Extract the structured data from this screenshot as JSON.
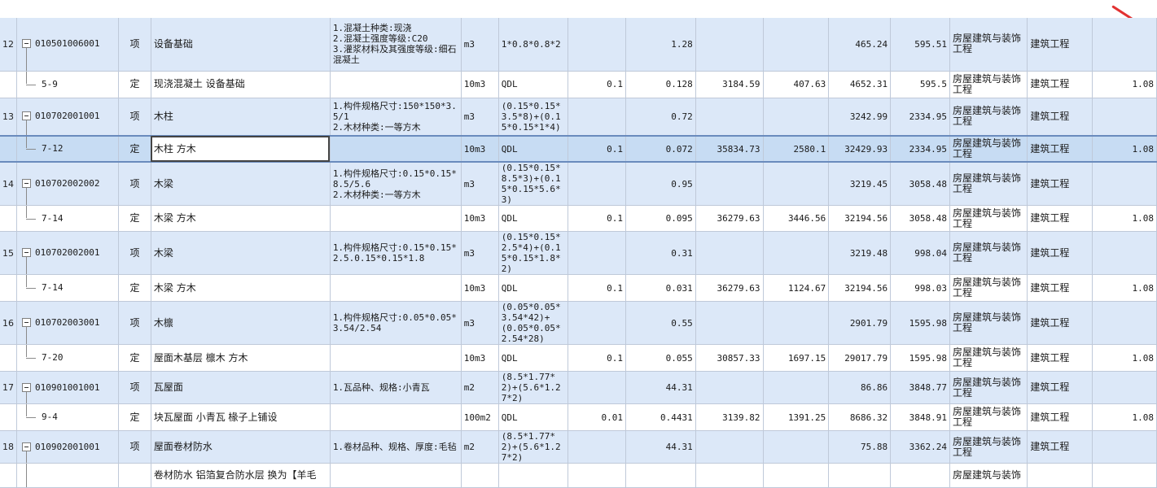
{
  "rows": [
    {
      "seq": "12",
      "type": "q",
      "code": "010501006001",
      "kind": "项",
      "name": "设备基础",
      "feature": "1.混凝土种类:现浇\n2.混凝土强度等级:C20\n3.灌浆材料及其强度等级:细石混凝土",
      "unit": "m3",
      "expr": "1*0.8*0.8*2",
      "coef": "",
      "qty": "1.28",
      "price": "",
      "amount": "",
      "unitprice": "465.24",
      "total": "595.51",
      "major": "房屋建筑与装饰工程",
      "category": "建筑工程",
      "extra": ""
    },
    {
      "seq": "",
      "type": "d",
      "code": "5-9",
      "kind": "定",
      "name": "现浇混凝土 设备基础",
      "feature": "",
      "unit": "10m3",
      "expr": "QDL",
      "coef": "0.1",
      "qty": "0.128",
      "price": "3184.59",
      "amount": "407.63",
      "unitprice": "4652.31",
      "total": "595.5",
      "major": "房屋建筑与装饰工程",
      "category": "建筑工程",
      "extra": "1.08"
    },
    {
      "seq": "13",
      "type": "q",
      "code": "010702001001",
      "kind": "项",
      "name": "木柱",
      "feature": "1.构件规格尺寸:150*150*3.5/1\n2.木材种类:一等方木",
      "unit": "m3",
      "expr": "(0.15*0.15*3.5*8)+(0.15*0.15*1*4)",
      "coef": "",
      "qty": "0.72",
      "price": "",
      "amount": "",
      "unitprice": "3242.99",
      "total": "2334.95",
      "major": "房屋建筑与装饰工程",
      "category": "建筑工程",
      "extra": ""
    },
    {
      "seq": "",
      "type": "d",
      "code": "7-12",
      "kind": "定",
      "name": "木柱 方木",
      "feature": "",
      "unit": "10m3",
      "expr": "QDL",
      "coef": "0.1",
      "qty": "0.072",
      "price": "35834.73",
      "amount": "2580.1",
      "unitprice": "32429.93",
      "total": "2334.95",
      "major": "房屋建筑与装饰工程",
      "category": "建筑工程",
      "extra": "1.08"
    },
    {
      "seq": "14",
      "type": "q",
      "code": "010702002002",
      "kind": "项",
      "name": "木梁",
      "feature": "1.构件规格尺寸:0.15*0.15*8.5/5.6\n2.木材种类:一等方木",
      "unit": "m3",
      "expr": "(0.15*0.15*8.5*3)+(0.15*0.15*5.6*3)",
      "coef": "",
      "qty": "0.95",
      "price": "",
      "amount": "",
      "unitprice": "3219.45",
      "total": "3058.48",
      "major": "房屋建筑与装饰工程",
      "category": "建筑工程",
      "extra": ""
    },
    {
      "seq": "",
      "type": "d",
      "code": "7-14",
      "kind": "定",
      "name": "木梁 方木",
      "feature": "",
      "unit": "10m3",
      "expr": "QDL",
      "coef": "0.1",
      "qty": "0.095",
      "price": "36279.63",
      "amount": "3446.56",
      "unitprice": "32194.56",
      "total": "3058.48",
      "major": "房屋建筑与装饰工程",
      "category": "建筑工程",
      "extra": "1.08"
    },
    {
      "seq": "15",
      "type": "q",
      "code": "010702002001",
      "kind": "项",
      "name": "木梁",
      "feature": "1.构件规格尺寸:0.15*0.15*2.5.0.15*0.15*1.8",
      "unit": "m3",
      "expr": "(0.15*0.15*2.5*4)+(0.15*0.15*1.8*2)",
      "coef": "",
      "qty": "0.31",
      "price": "",
      "amount": "",
      "unitprice": "3219.48",
      "total": "998.04",
      "major": "房屋建筑与装饰工程",
      "category": "建筑工程",
      "extra": ""
    },
    {
      "seq": "",
      "type": "d",
      "code": "7-14",
      "kind": "定",
      "name": "木梁 方木",
      "feature": "",
      "unit": "10m3",
      "expr": "QDL",
      "coef": "0.1",
      "qty": "0.031",
      "price": "36279.63",
      "amount": "1124.67",
      "unitprice": "32194.56",
      "total": "998.03",
      "major": "房屋建筑与装饰工程",
      "category": "建筑工程",
      "extra": "1.08"
    },
    {
      "seq": "16",
      "type": "q",
      "code": "010702003001",
      "kind": "项",
      "name": "木檩",
      "feature": "1.构件规格尺寸:0.05*0.05*3.54/2.54",
      "unit": "m3",
      "expr": "(0.05*0.05*3.54*42)+(0.05*0.05*2.54*28)",
      "coef": "",
      "qty": "0.55",
      "price": "",
      "amount": "",
      "unitprice": "2901.79",
      "total": "1595.98",
      "major": "房屋建筑与装饰工程",
      "category": "建筑工程",
      "extra": ""
    },
    {
      "seq": "",
      "type": "d",
      "code": "7-20",
      "kind": "定",
      "name": "屋面木基层 檩木 方木",
      "feature": "",
      "unit": "10m3",
      "expr": "QDL",
      "coef": "0.1",
      "qty": "0.055",
      "price": "30857.33",
      "amount": "1697.15",
      "unitprice": "29017.79",
      "total": "1595.98",
      "major": "房屋建筑与装饰工程",
      "category": "建筑工程",
      "extra": "1.08"
    },
    {
      "seq": "17",
      "type": "q",
      "code": "010901001001",
      "kind": "项",
      "name": "瓦屋面",
      "feature": "1.瓦品种、规格:小青瓦",
      "unit": "m2",
      "expr": "(8.5*1.77*2)+(5.6*1.27*2)",
      "coef": "",
      "qty": "44.31",
      "price": "",
      "amount": "",
      "unitprice": "86.86",
      "total": "3848.77",
      "major": "房屋建筑与装饰工程",
      "category": "建筑工程",
      "extra": ""
    },
    {
      "seq": "",
      "type": "d",
      "code": "9-4",
      "kind": "定",
      "name": "块瓦屋面 小青瓦 椽子上铺设",
      "feature": "",
      "unit": "100m2",
      "expr": "QDL",
      "coef": "0.01",
      "qty": "0.4431",
      "price": "3139.82",
      "amount": "1391.25",
      "unitprice": "8686.32",
      "total": "3848.91",
      "major": "房屋建筑与装饰工程",
      "category": "建筑工程",
      "extra": "1.08"
    },
    {
      "seq": "18",
      "type": "q",
      "code": "010902001001",
      "kind": "项",
      "name": "屋面卷材防水",
      "feature": "1.卷材品种、规格、厚度:毛毡",
      "unit": "m2",
      "expr": "(8.5*1.77*2)+(5.6*1.27*2)",
      "coef": "",
      "qty": "44.31",
      "price": "",
      "amount": "",
      "unitprice": "75.88",
      "total": "3362.24",
      "major": "房屋建筑与装饰工程",
      "category": "建筑工程",
      "extra": ""
    },
    {
      "seq": "",
      "type": "d",
      "code": "",
      "kind": "",
      "name": "卷材防水 铝箔复合防水层 换为【羊毛",
      "feature": "",
      "unit": "",
      "expr": "",
      "coef": "",
      "qty": "",
      "price": "",
      "amount": "",
      "unitprice": "",
      "total": "",
      "major": "房屋建筑与装饰",
      "category": "",
      "extra": ""
    }
  ]
}
